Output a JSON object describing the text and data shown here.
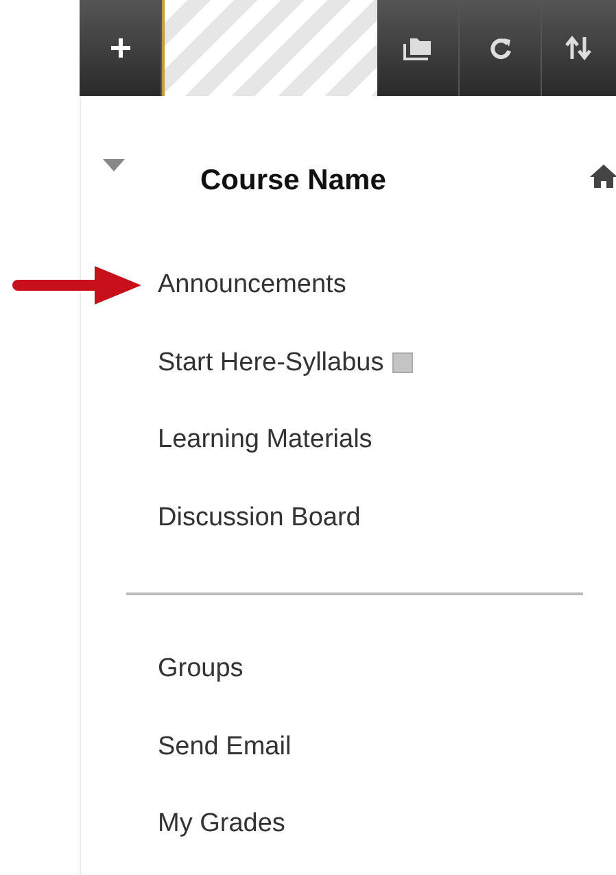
{
  "course": {
    "title": "Course Name",
    "expanded": true
  },
  "menu_groups": [
    {
      "items": [
        {
          "label": "Announcements",
          "pointed": true,
          "kind": "link"
        },
        {
          "label": "Start Here-Syllabus",
          "pointed": false,
          "kind": "tagged"
        },
        {
          "label": "Learning Materials",
          "pointed": false,
          "kind": "link"
        },
        {
          "label": "Discussion Board",
          "pointed": false,
          "kind": "link"
        }
      ]
    },
    {
      "items": [
        {
          "label": "Groups",
          "pointed": false,
          "kind": "link"
        },
        {
          "label": "Send Email",
          "pointed": false,
          "kind": "link"
        },
        {
          "label": "My Grades",
          "pointed": false,
          "kind": "link"
        }
      ]
    }
  ]
}
